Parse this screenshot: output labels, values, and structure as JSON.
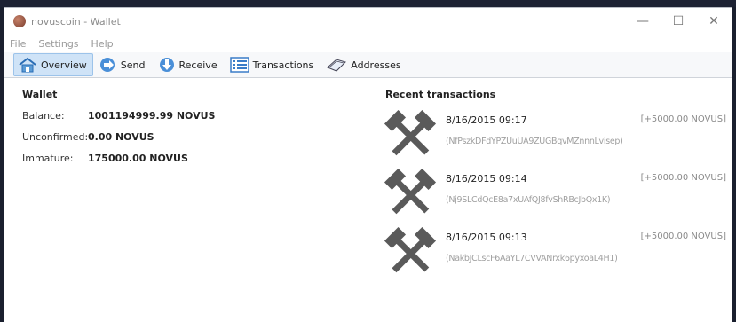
{
  "window": {
    "title": "novuscoin - Wallet"
  },
  "menu": [
    {
      "label": "File"
    },
    {
      "label": "Settings"
    },
    {
      "label": "Help"
    }
  ],
  "toolbar": [
    {
      "label": "Overview",
      "icon": "home-icon",
      "active": true
    },
    {
      "label": "Send",
      "icon": "send-arrow-icon"
    },
    {
      "label": "Receive",
      "icon": "receive-arrow-icon"
    },
    {
      "label": "Transactions",
      "icon": "list-icon"
    },
    {
      "label": "Addresses",
      "icon": "address-book-icon"
    }
  ],
  "wallet": {
    "title": "Wallet",
    "balance_label": "Balance:",
    "balance_value": "1001194999.99 NOVUS",
    "unconfirmed_label": "Unconfirmed:",
    "unconfirmed_value": "0.00 NOVUS",
    "immature_label": "Immature:",
    "immature_value": "175000.00 NOVUS"
  },
  "recent": {
    "title": "Recent transactions",
    "items": [
      {
        "date": "8/16/2015 09:17",
        "amount": "[+5000.00 NOVUS]",
        "address": "(NfPszkDFdYPZUuUA9ZUGBqvMZnnnLvisep)"
      },
      {
        "date": "8/16/2015 09:14",
        "amount": "[+5000.00 NOVUS]",
        "address": "(Nj9SLCdQcE8a7xUAfQJ8fvShRBcJbQx1K)"
      },
      {
        "date": "8/16/2015 09:13",
        "amount": "[+5000.00 NOVUS]",
        "address": "(NakbJCLscF6AaYL7CVVANrxk6pyxoaL4H1)"
      }
    ]
  },
  "colors": {
    "accent": "#cfe3f7",
    "muted": "#8a8a8a"
  }
}
